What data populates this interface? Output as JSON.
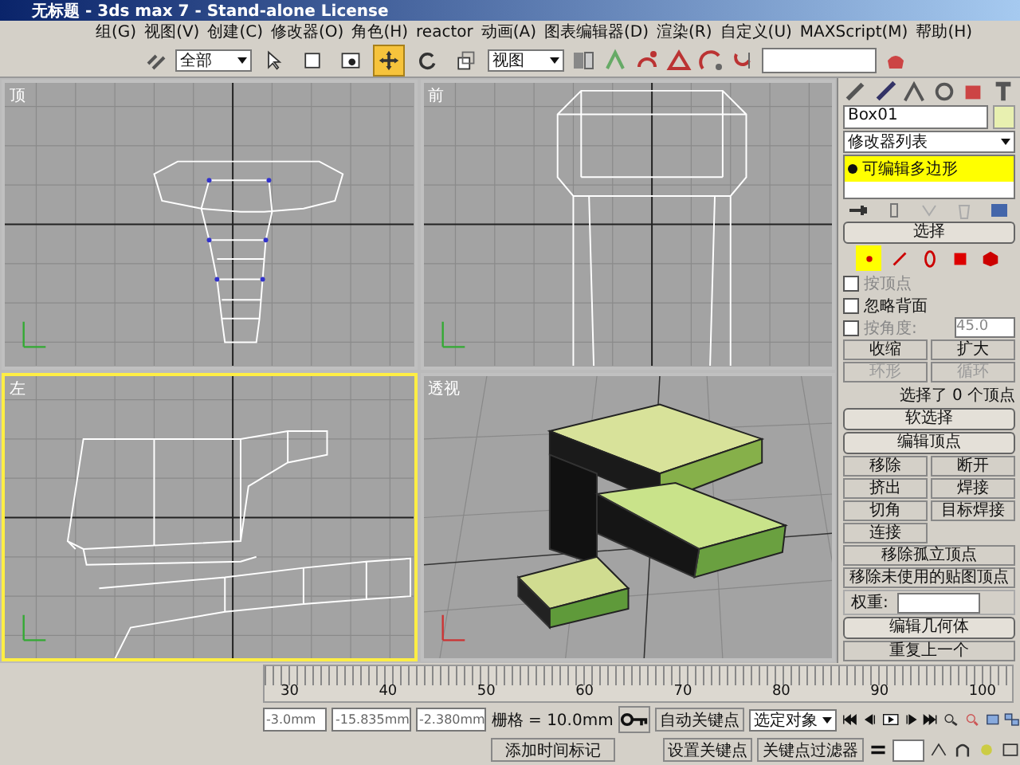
{
  "window": {
    "title": "无标题 - 3ds max 7 - Stand-alone License"
  },
  "menu": [
    "组(G)",
    "视图(V)",
    "创建(C)",
    "修改器(O)",
    "角色(H)",
    "reactor",
    "动画(A)",
    "图表编辑器(D)",
    "渲染(R)",
    "自定义(U)",
    "MAXScript(M)",
    "帮助(H)"
  ],
  "toolbar": {
    "selection_filter": "全部",
    "reference_coord": "视图",
    "tools": [
      {
        "kind": "select",
        "selected": false
      },
      {
        "kind": "region",
        "selected": false
      },
      {
        "kind": "window",
        "selected": false
      },
      {
        "kind": "move",
        "selected": true
      },
      {
        "kind": "rotate",
        "selected": false
      },
      {
        "kind": "scale",
        "selected": false
      }
    ]
  },
  "viewports": [
    {
      "label": "顶",
      "kind": "top",
      "selected": false
    },
    {
      "label": "前",
      "kind": "front",
      "selected": false
    },
    {
      "label": "左",
      "kind": "left",
      "selected": true
    },
    {
      "label": "透视",
      "kind": "perspective",
      "selected": false
    }
  ],
  "command_panel": {
    "object_name": "Box01",
    "modifier_list": "修改器列表",
    "stack": [
      {
        "label": "可编辑多边形",
        "selected": true
      }
    ],
    "selection": {
      "title": "选择",
      "levels": [
        {
          "kind": "vertex",
          "selected": true
        },
        {
          "kind": "edge",
          "selected": false
        },
        {
          "kind": "border",
          "selected": false
        },
        {
          "kind": "polygon",
          "selected": false
        },
        {
          "kind": "element",
          "selected": false
        }
      ],
      "checkboxes": [
        {
          "label": "按顶点",
          "checked": false,
          "disabled": true
        },
        {
          "label": "忽略背面",
          "checked": false,
          "disabled": false
        },
        {
          "label": "按角度:",
          "checked": false,
          "disabled": true
        }
      ],
      "angle": "45.0",
      "buttons": [
        {
          "label": "收缩",
          "disabled": false
        },
        {
          "label": "扩大",
          "disabled": false
        },
        {
          "label": "环形",
          "disabled": true
        },
        {
          "label": "循环",
          "disabled": true
        }
      ],
      "status": "选择了 0 个顶点"
    },
    "soft_selection": "软选择",
    "edit_vertices": {
      "title": "编辑顶点",
      "buttons": [
        {
          "label": "移除",
          "wide": false
        },
        {
          "label": "断开",
          "wide": false
        },
        {
          "label": "挤出",
          "wide": false
        },
        {
          "label": "焊接",
          "wide": false
        },
        {
          "label": "切角",
          "wide": false
        },
        {
          "label": "目标焊接",
          "wide": false
        },
        {
          "label": "连接",
          "wide": false
        },
        {
          "label": "移除孤立顶点",
          "wide": true
        },
        {
          "label": "移除未使用的贴图顶点",
          "wide": true
        }
      ],
      "weight_label": "权重:"
    },
    "edit_geometry": {
      "title": "编辑几何体",
      "button": "重复上一个"
    }
  },
  "timeline": {
    "ticks": [
      "30",
      "40",
      "50",
      "60",
      "70",
      "80",
      "90",
      "100"
    ]
  },
  "status_bar": {
    "x": "-3.0mm",
    "y": "-15.835mm",
    "z": "-2.380mm",
    "grid": "栅格 = 10.0mm",
    "add_time_tag": "添加时间标记",
    "auto_key": "自动关键点",
    "set_key": "设置关键点",
    "key_mode": "选定对象",
    "key_filters": "关键点过滤器"
  }
}
